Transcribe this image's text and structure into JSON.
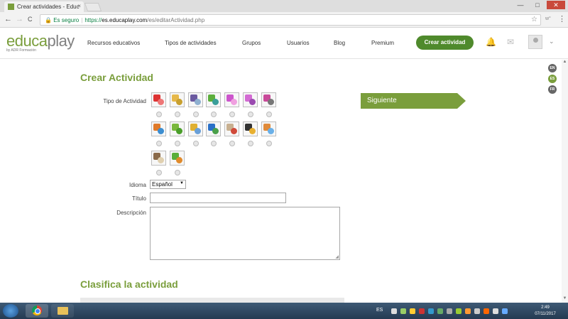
{
  "browser": {
    "tab_title": "Crear actividades - Educ",
    "tab_close": "×",
    "win_min": "—",
    "win_max": "□",
    "win_close": "✕",
    "back": "←",
    "forward": "→",
    "reload": "C",
    "secure_label": "Es seguro",
    "url_scheme": "https://",
    "url_host": "es.educaplay.com",
    "url_path": "/es/editarActividad.php",
    "star": "☆",
    "ext": "w°",
    "menu": "⋮"
  },
  "site": {
    "logo_edu": "educa",
    "logo_play": "play",
    "logo_sub": "by ADR Formación",
    "nav": [
      "Recursos educativos",
      "Tipos de actividades",
      "Grupos",
      "Usuarios",
      "Blog",
      "Premium"
    ],
    "create_button": "Crear actividad",
    "bell_icon": "🔔",
    "mail_icon": "✉",
    "chevron": "⌄",
    "languages": [
      "EN",
      "ES",
      "FR"
    ]
  },
  "form": {
    "title": "Crear Actividad",
    "tipo_label": "Tipo de Actividad",
    "activity_icon_colors": [
      [
        "#d33",
        "#e77"
      ],
      [
        "#e6b84a",
        "#c8a030"
      ],
      [
        "#6b5aa0",
        "#8fb0d0"
      ],
      [
        "#5cae3c",
        "#3a9e9a"
      ],
      [
        "#cc55cc",
        "#f0a0e0"
      ],
      [
        "#d36bd3",
        "#9a4ab0"
      ],
      [
        "#c94a9a",
        "#777"
      ],
      [
        "#e07a2a",
        "#3c8ed0"
      ],
      [
        "#7ab83c",
        "#4a9e2a"
      ],
      [
        "#e0b030",
        "#6aa0d8"
      ],
      [
        "#2a70c8",
        "#4aa04a"
      ],
      [
        "#c8b090",
        "#d04a3a"
      ],
      [
        "#333",
        "#e8b030"
      ],
      [
        "#e08a3a",
        "#6ab0e8"
      ],
      [
        "#8a6a4a",
        "#e0d0b0"
      ],
      [
        "#5aae3a",
        "#e08a2a"
      ]
    ],
    "idioma_label": "Idioma",
    "idioma_value": "Español",
    "select_arrow": "▼",
    "titulo_label": "Título",
    "descripcion_label": "Descripción",
    "grip": "◢",
    "next_button": "Siguiente",
    "section2_title": "Clasifica la actividad"
  },
  "scrollbar": {
    "up": "▲",
    "down": "▼"
  },
  "taskbar": {
    "language": "ES",
    "time": "2:49",
    "date": "07/11/2017",
    "tray_colors": [
      "#ddd",
      "#9c6",
      "#fc3",
      "#c33",
      "#39c",
      "#6a6",
      "#aaa",
      "#9c3",
      "#f93",
      "#ccc",
      "#f60",
      "#ddd",
      "#6af"
    ]
  }
}
